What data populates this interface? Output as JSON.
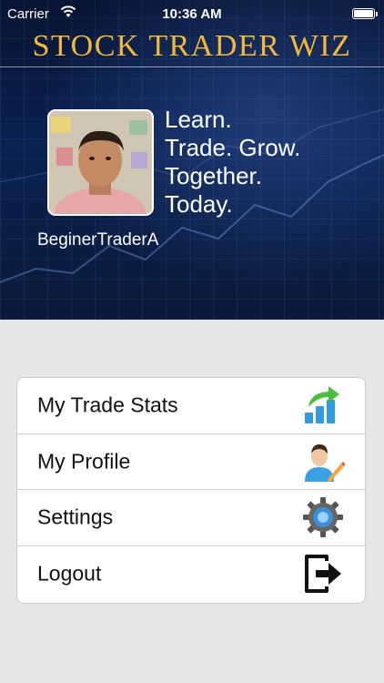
{
  "status_bar": {
    "carrier": "Carrier",
    "time": "10:36 AM"
  },
  "header": {
    "app_title": "STOCK TRADER WIZ",
    "tagline": [
      "Learn.",
      "Trade. Grow.",
      "Together.",
      "Today."
    ],
    "username": "BeginerTraderA"
  },
  "menu": {
    "items": [
      {
        "label": "My Trade Stats",
        "icon": "trade-stats-icon"
      },
      {
        "label": "My Profile",
        "icon": "profile-edit-icon"
      },
      {
        "label": "Settings",
        "icon": "gear-icon"
      },
      {
        "label": "Logout",
        "icon": "logout-icon"
      }
    ]
  },
  "colors": {
    "title_gold": "#f2b83a",
    "hero_bg": "#0b2150",
    "page_bg": "#e6e6e6"
  }
}
